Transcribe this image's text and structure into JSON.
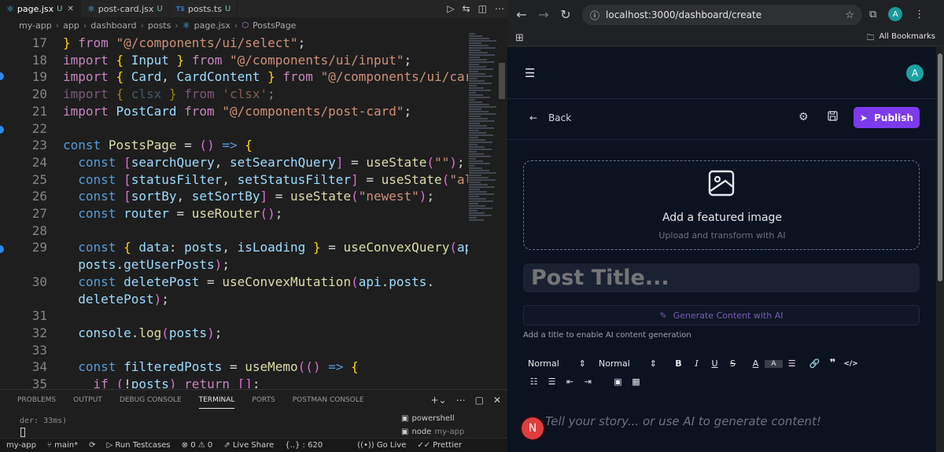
{
  "vscode": {
    "tabs": [
      {
        "icon": "react",
        "name": "page.jsx",
        "status": "U",
        "active": true
      },
      {
        "icon": "react",
        "name": "post-card.jsx",
        "status": "U"
      },
      {
        "icon": "TS",
        "name": "posts.ts",
        "status": "U"
      }
    ],
    "breadcrumb": [
      "my-app",
      "app",
      "dashboard",
      "posts",
      "page.jsx",
      "PostsPage"
    ],
    "panel_tabs": [
      "PROBLEMS",
      "OUTPUT",
      "DEBUG CONSOLE",
      "TERMINAL",
      "PORTS",
      "POSTMAN CONSOLE"
    ],
    "terminal_text": "der: 33ms)",
    "terminals": [
      "powershell",
      "node",
      "my-app"
    ],
    "status": {
      "project": "my-app",
      "branch": "main*",
      "run": "Run Testcases",
      "errors": "0",
      "warnings": "0",
      "liveshare": "Live Share",
      "position": "{..} : 620",
      "golive": "Go Live",
      "prettier": "Prettier"
    }
  },
  "code_lines": [
    {
      "n": "17",
      "code": "} from \"@/components/ui/select\";"
    },
    {
      "n": "18",
      "code": "import { Input } from \"@/components/ui/input\";"
    },
    {
      "n": "19",
      "code": "import { Card, CardContent } from \"@/components/ui/card\";"
    },
    {
      "n": "20",
      "code": "import { clsx } from 'clsx';"
    },
    {
      "n": "21",
      "code": "import PostCard from \"@/components/post-card\";"
    },
    {
      "n": "22",
      "code": ""
    },
    {
      "n": "23",
      "code": "const PostsPage = () => {"
    },
    {
      "n": "24",
      "code": "  const [searchQuery, setSearchQuery] = useState(\"\");"
    },
    {
      "n": "25",
      "code": "  const [statusFilter, setStatusFilter] = useState(\"all\");"
    },
    {
      "n": "26",
      "code": "  const [sortBy, setSortBy] = useState(\"newest\");"
    },
    {
      "n": "27",
      "code": "  const router = useRouter();"
    },
    {
      "n": "28",
      "code": ""
    },
    {
      "n": "29",
      "code": "  const { data: posts, isLoading } = useConvexQuery(api."
    },
    {
      "n": "",
      "code": "  posts.getUserPosts);"
    },
    {
      "n": "30",
      "code": "  const deletePost = useConvexMutation(api.posts."
    },
    {
      "n": "",
      "code": "  deletePost);"
    },
    {
      "n": "31",
      "code": ""
    },
    {
      "n": "32",
      "code": "  console.log(posts);"
    },
    {
      "n": "33",
      "code": ""
    },
    {
      "n": "34",
      "code": "  const filteredPosts = useMemo(() => {"
    },
    {
      "n": "35",
      "code": "    if (!posts) return [];"
    }
  ],
  "browser": {
    "url": "localhost:3000/dashboard/create",
    "profile_initial": "A",
    "bookmarks_label": "All Bookmarks"
  },
  "app": {
    "avatar_initial": "A",
    "back_label": "Back",
    "publish_label": "Publish",
    "dropzone_title": "Add a featured image",
    "dropzone_subtitle": "Upload and transform with AI",
    "title_placeholder": "Post Title...",
    "generate_label": "Generate Content with AI",
    "hint": "Add a title to enable AI content generation",
    "format_selects": [
      "Normal",
      "Normal"
    ],
    "story_placeholder": "Tell your story... or use AI to generate content!",
    "badge_letter": "N",
    "colors": {
      "accent": "#7c3aed",
      "background": "#0b1220",
      "badge": "#e03e3e"
    }
  }
}
